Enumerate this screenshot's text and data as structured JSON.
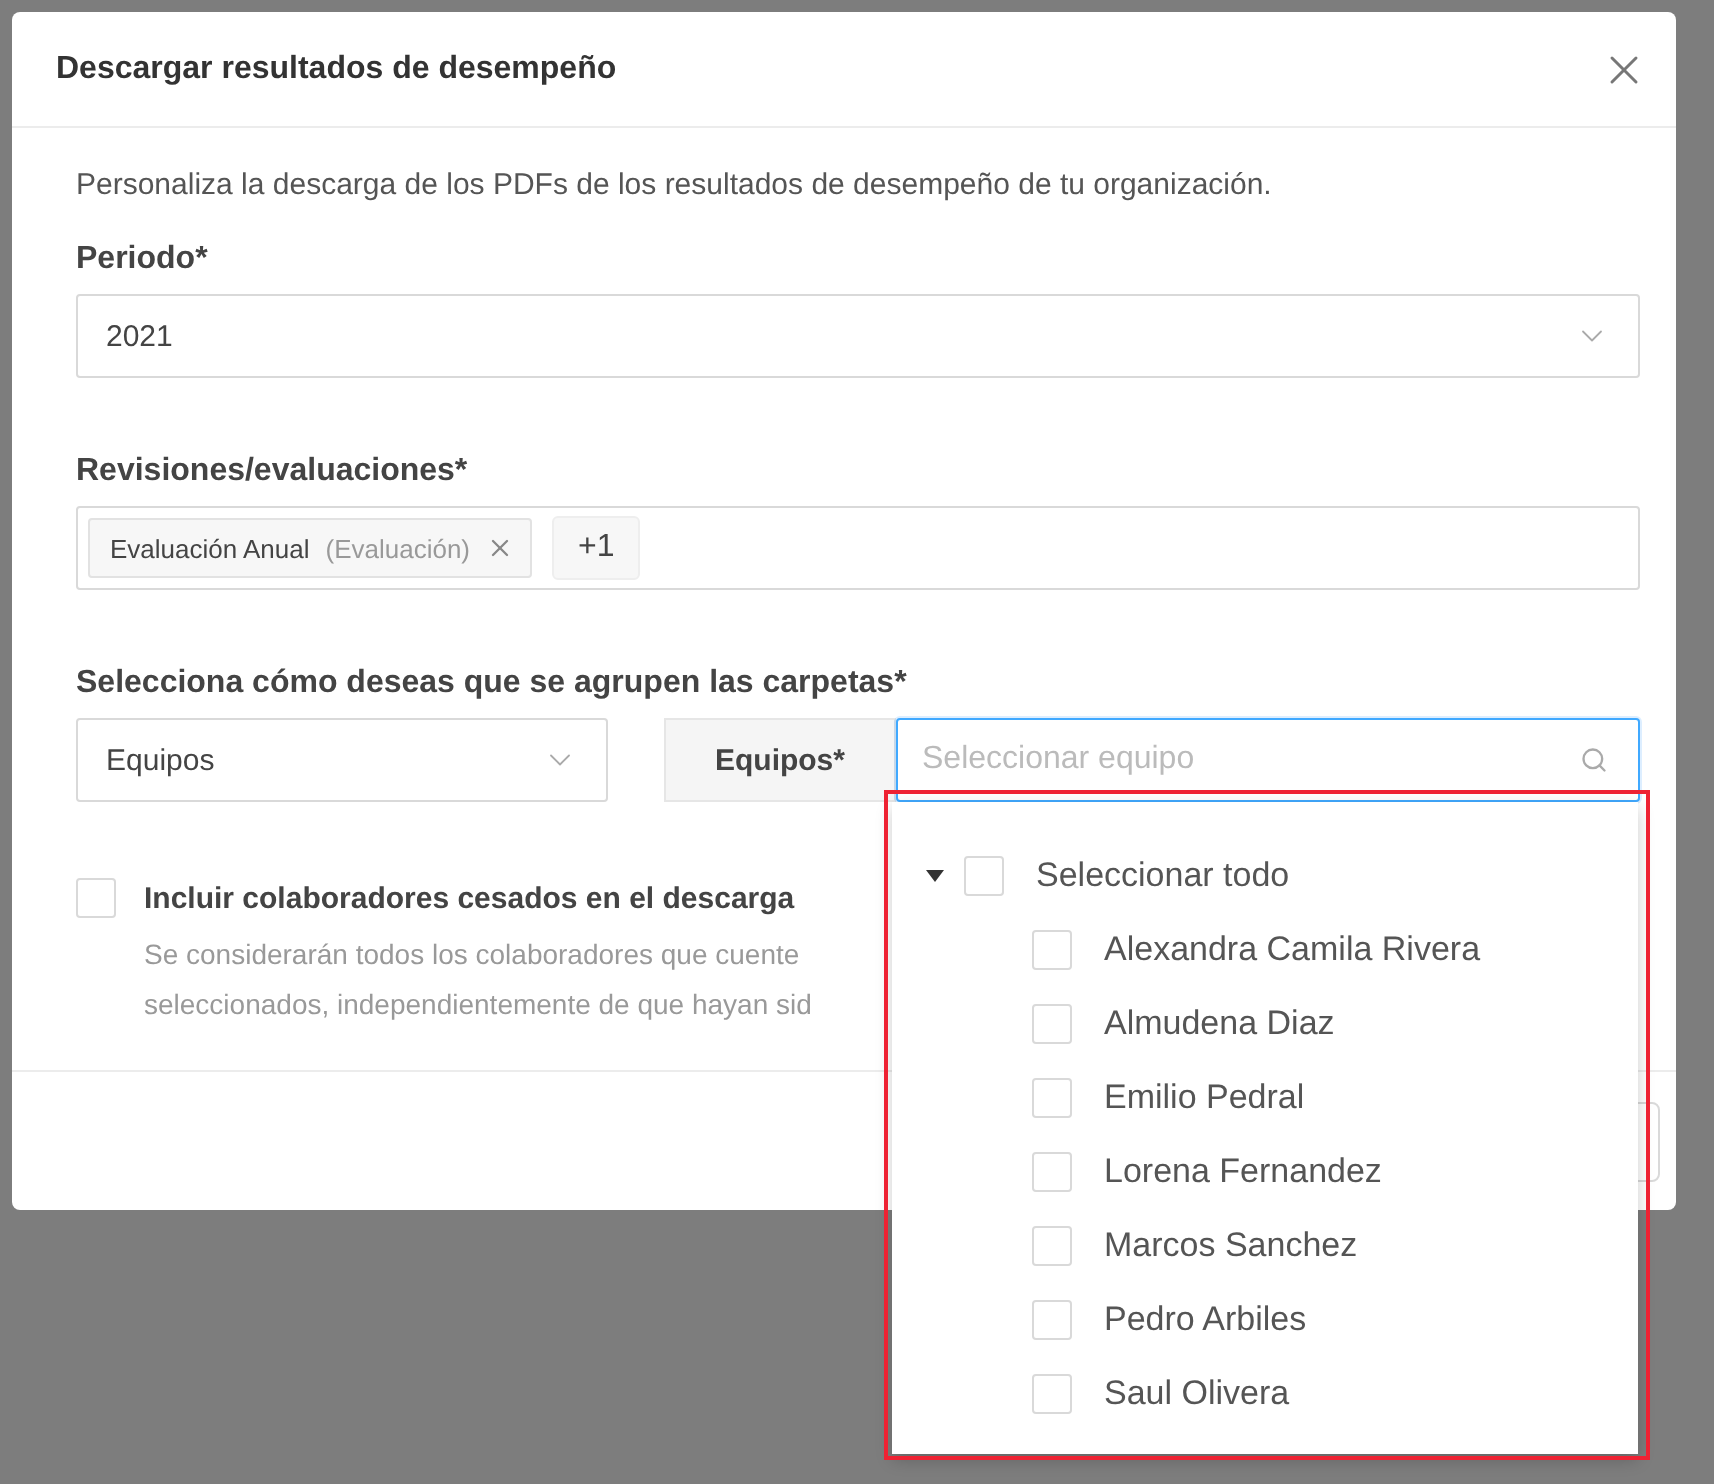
{
  "dialog": {
    "title": "Descargar resultados de desempeño",
    "description": "Personaliza la descarga de los PDFs de los resultados de desempeño de tu organización.",
    "period": {
      "label": "Periodo*",
      "value": "2021"
    },
    "reviews": {
      "label": "Revisiones/evaluaciones*",
      "tags": [
        {
          "text": "Evaluación Anual",
          "note": "(Evaluación)"
        }
      ],
      "more": "+1"
    },
    "grouping": {
      "label": "Selecciona cómo deseas que se agrupen las carpetas*",
      "group_by": "Equipos",
      "addon": "Equipos*",
      "search": {
        "placeholder": "Seleccionar equipo"
      }
    },
    "include_ceased": {
      "label": "Incluir colaboradores cesados en el descarga",
      "checked": false,
      "help": [
        "Se considerarán todos los colaboradores que cuente",
        "seleccionados, independientemente de que hayan sid"
      ]
    }
  },
  "dropdown": {
    "select_all": {
      "label": "Seleccionar todo",
      "checked": false,
      "expanded": true
    },
    "items": [
      {
        "label": "Alexandra Camila Rivera",
        "checked": false
      },
      {
        "label": "Almudena Diaz",
        "checked": false
      },
      {
        "label": "Emilio Pedral",
        "checked": false
      },
      {
        "label": "Lorena Fernandez",
        "checked": false
      },
      {
        "label": "Marcos Sanchez",
        "checked": false
      },
      {
        "label": "Pedro Arbiles",
        "checked": false
      },
      {
        "label": "Saul Olivera",
        "checked": false
      }
    ]
  }
}
